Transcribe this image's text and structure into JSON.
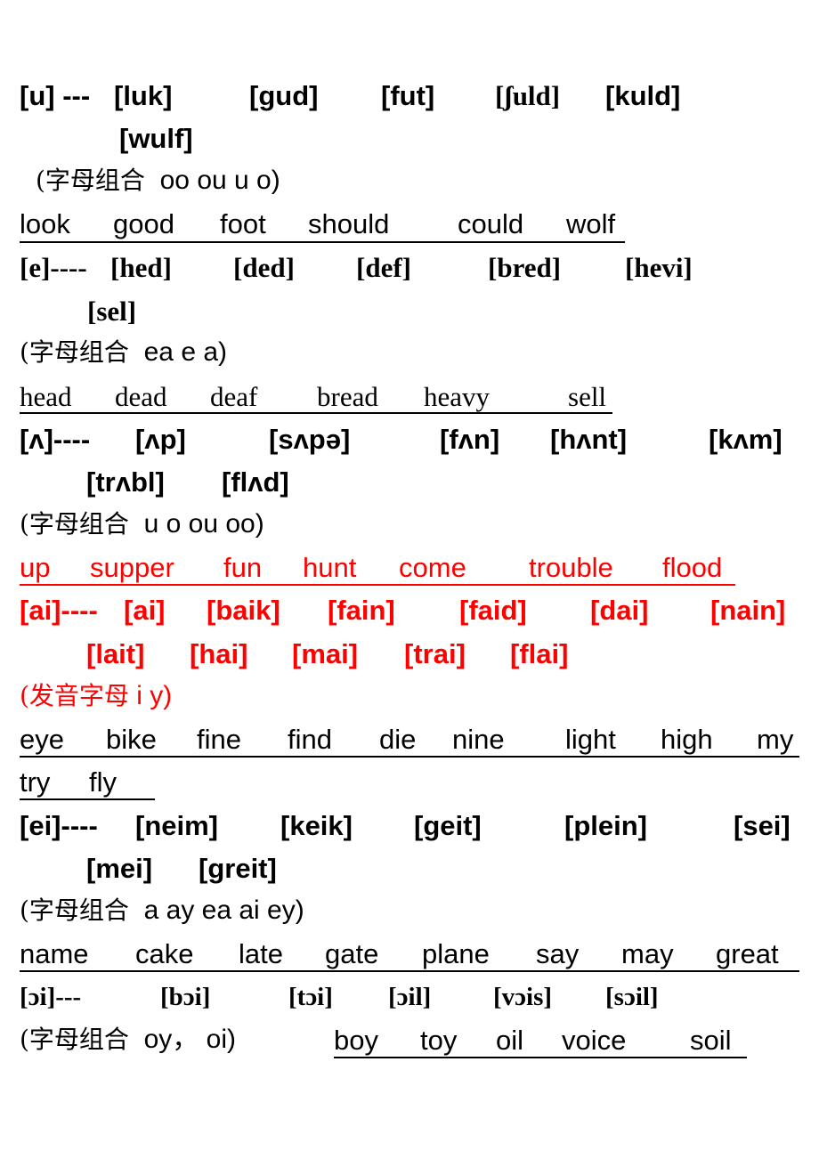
{
  "sections": [
    {
      "id": "u",
      "color": "#000000",
      "phonetic_header": "[u] ---",
      "transcriptions": [
        "[luk]",
        "[gud]",
        "[fut]",
        "[ʃuld]",
        "[kuld]",
        "[wulf]"
      ],
      "note_label": "(字母组合",
      "note_letters": "oo ou u o)",
      "words": [
        "look",
        "good",
        "foot",
        "should",
        "could",
        "wolf"
      ]
    },
    {
      "id": "e",
      "color": "#000000",
      "phonetic_header": "[e]----",
      "transcriptions": [
        "[hed]",
        "[ded]",
        "[def]",
        "[bred]",
        "[hevi]",
        "[sel]"
      ],
      "note_label": "(字母组合",
      "note_letters": "ea e a)",
      "words": [
        "head",
        "dead",
        "deaf",
        "bread",
        "heavy",
        "sell"
      ]
    },
    {
      "id": "wedge",
      "color": "#000000",
      "phonetic_header": "[ʌ]----",
      "transcriptions": [
        "[ʌp]",
        "[sʌpə]",
        "[fʌn]",
        "[hʌnt]",
        "[kʌm]",
        "[trʌbl]",
        "[flʌd]"
      ],
      "note_label": "(字母组合",
      "note_letters": "u o ou oo)",
      "words_color": "#ff0000",
      "words": [
        "up",
        "supper",
        "fun",
        "hunt",
        "come",
        "trouble",
        "flood"
      ]
    },
    {
      "id": "ai",
      "color": "#ff0000",
      "phonetic_header": "[ai]----",
      "transcriptions": [
        "[ai]",
        "[baik]",
        "[fain]",
        "[faid]",
        "[dai]",
        "[nain]",
        "[lait]",
        "[hai]",
        "[mai]",
        "[trai]",
        "[flai]"
      ],
      "note_label": "(发音字母",
      "note_letters": "i y)",
      "words": [
        "eye",
        "bike",
        "fine",
        "find",
        "die",
        "nine",
        "light",
        "high",
        "my",
        "try",
        "fly"
      ]
    },
    {
      "id": "ei",
      "color": "#000000",
      "phonetic_header": "[ei]----",
      "transcriptions": [
        "[neim]",
        "[keik]",
        "[geit]",
        "[plein]",
        "[sei]",
        "[mei]",
        "[greit]"
      ],
      "note_label": "(字母组合",
      "note_letters": "a ay ea ai ey)",
      "words": [
        "name",
        "cake",
        "late",
        "gate",
        "plane",
        "say",
        "may",
        "great"
      ]
    },
    {
      "id": "oi",
      "color": "#000000",
      "phonetic_header": "[ɔi]---",
      "transcriptions": [
        "[bɔi]",
        "[tɔi]",
        "[ɔil]",
        "[vɔis]",
        "[sɔil]"
      ],
      "note_label": "(字母组合",
      "note_letters": "oy， oi)",
      "words": [
        "boy",
        "toy",
        "oil",
        "voice",
        "soil"
      ]
    }
  ]
}
